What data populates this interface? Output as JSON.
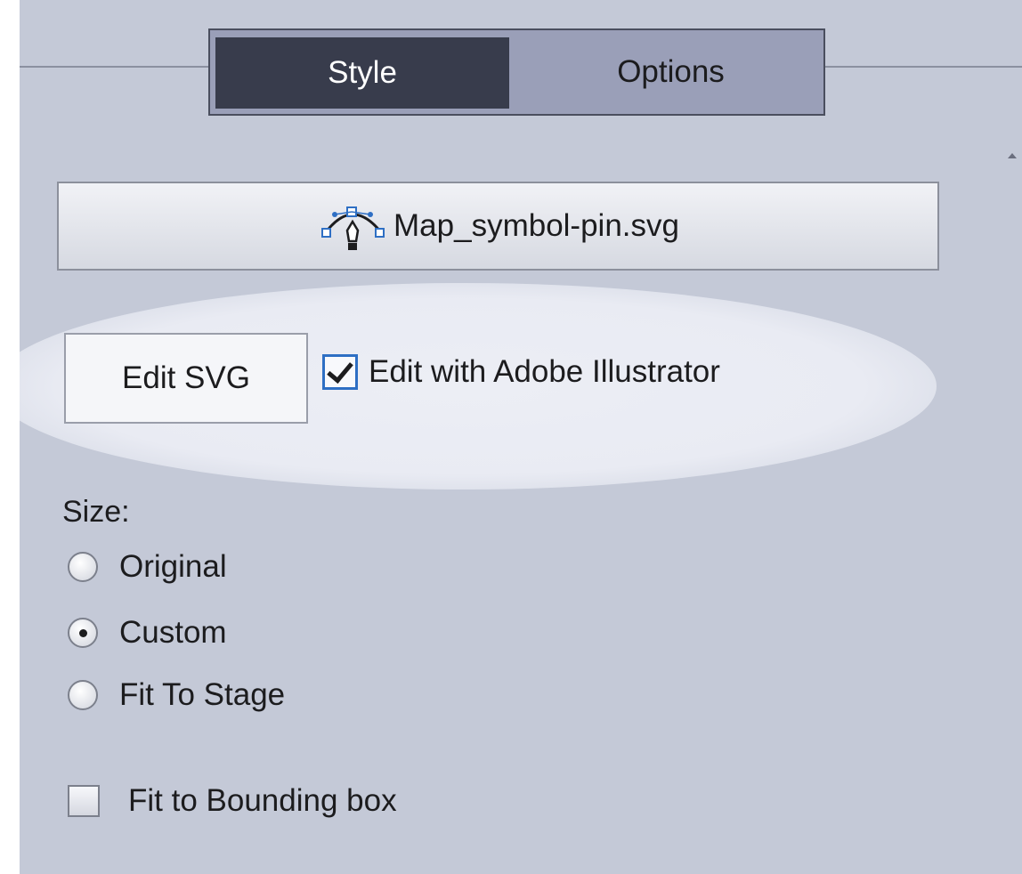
{
  "tabs": {
    "style_label": "Style",
    "options_label": "Options"
  },
  "file": {
    "name": "Map_symbol-pin.svg",
    "icon": "pen-curve-icon"
  },
  "edit": {
    "edit_svg_label": "Edit SVG",
    "illustrator_label": "Edit with Adobe Illustrator",
    "illustrator_checked": true
  },
  "size": {
    "label": "Size:",
    "options": [
      {
        "label": "Original",
        "selected": false
      },
      {
        "label": "Custom",
        "selected": true
      },
      {
        "label": "Fit To Stage",
        "selected": false
      }
    ]
  },
  "fit_bbox": {
    "label": "Fit to Bounding box",
    "checked": false
  },
  "colors": {
    "panel_bg": "#c4c9d7",
    "active_tab": "#383c4c",
    "checkbox_border": "#2e6fc4"
  }
}
